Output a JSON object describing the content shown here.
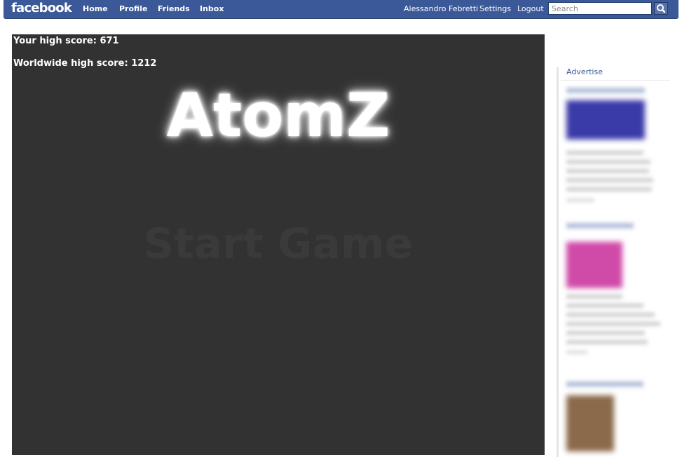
{
  "topbar": {
    "logo": "facebook",
    "nav": [
      "Home",
      "Profile",
      "Friends",
      "Inbox"
    ],
    "user_name": "Alessandro Febretti",
    "settings": "Settings",
    "logout": "Logout",
    "search_placeholder": "Search",
    "search_icon": "magnifier-icon",
    "brand_color": "#3b5998"
  },
  "game": {
    "your_high_score": "Your high score: 671",
    "worldwide_high_score": "Worldwide high score: 1212",
    "title": "AtomZ",
    "start": "Start Game",
    "background": "#323232"
  },
  "sidebar": {
    "advertise": "Advertise"
  }
}
